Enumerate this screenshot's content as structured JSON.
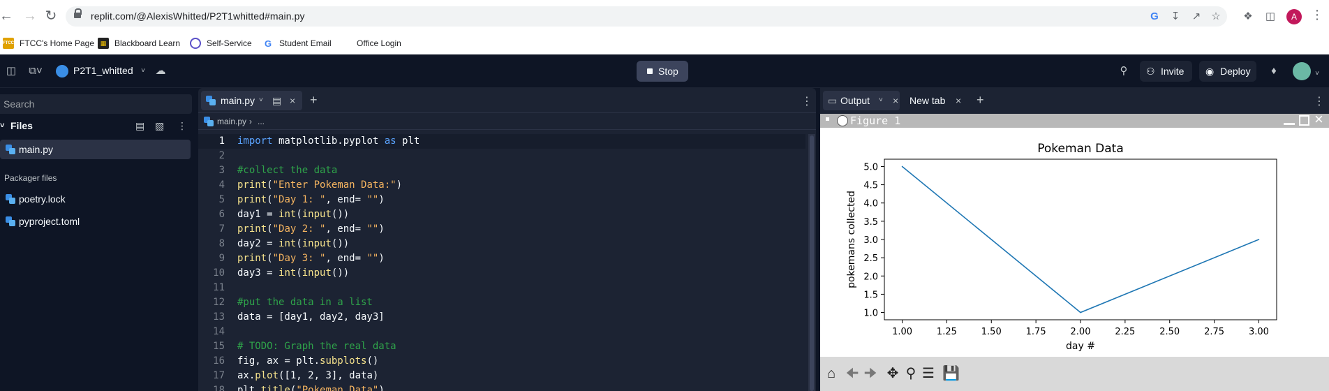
{
  "browser": {
    "url": "replit.com/@AlexisWhitted/P2T1whitted#main.py",
    "profile_initial": "A",
    "bookmarks": [
      {
        "label": "FTCC's Home Page",
        "icon": "ftcc-icon",
        "color": "#e0a100"
      },
      {
        "label": "Blackboard Learn",
        "icon": "blackboard-icon",
        "color": "#222222"
      },
      {
        "label": "Self-Service",
        "icon": "self-service-icon",
        "color": "#5a50c8"
      },
      {
        "label": "Student Email",
        "icon": "google-icon",
        "color": "#4285f4"
      },
      {
        "label": "Office Login",
        "icon": "microsoft-icon",
        "color": "#f25022"
      }
    ]
  },
  "replit": {
    "repl_name": "P2T1_whitted",
    "stop_label": "Stop",
    "invite_label": "Invite",
    "deploy_label": "Deploy"
  },
  "sidebar": {
    "search_placeholder": "Search",
    "files_header": "Files",
    "files": [
      "main.py"
    ],
    "packager_header": "Packager files",
    "packager_files": [
      "poetry.lock",
      "pyproject.toml"
    ]
  },
  "editor": {
    "tab_label": "main.py",
    "breadcrumb_file": "main.py",
    "breadcrumb_more": "...",
    "lines": [
      "import matplotlib.pyplot as plt",
      "",
      "#collect the data",
      "print(\"Enter Pokeman Data:\")",
      "print(\"Day 1: \", end= \"\")",
      "day1 = int(input())",
      "print(\"Day 2: \", end= \"\")",
      "day2 = int(input())",
      "print(\"Day 3: \", end= \"\")",
      "day3 = int(input())",
      "",
      "#put the data in a list",
      "data = [day1, day2, day3]",
      "",
      "# TODO: Graph the real data",
      "fig, ax = plt.subplots()",
      "ax.plot([1, 2, 3], data)",
      "plt.title(\"Pokeman Data\")"
    ]
  },
  "output": {
    "tab_output": "Output",
    "tab_new": "New tab",
    "figure_title": "Figure 1"
  },
  "chart_data": {
    "type": "line",
    "title": "Pokeman Data",
    "xlabel": "day #",
    "ylabel": "pokemans collected",
    "x": [
      1,
      2,
      3
    ],
    "series": [
      {
        "values": [
          5,
          1,
          3
        ],
        "color": "#1f77b4"
      }
    ],
    "xlim": [
      0.9,
      3.1
    ],
    "ylim": [
      0.8,
      5.2
    ],
    "xticks": [
      "1.00",
      "1.25",
      "1.50",
      "1.75",
      "2.00",
      "2.25",
      "2.50",
      "2.75",
      "3.00"
    ],
    "yticks": [
      "1.0",
      "1.5",
      "2.0",
      "2.5",
      "3.0",
      "3.5",
      "4.0",
      "4.5",
      "5.0"
    ],
    "grid": false
  }
}
